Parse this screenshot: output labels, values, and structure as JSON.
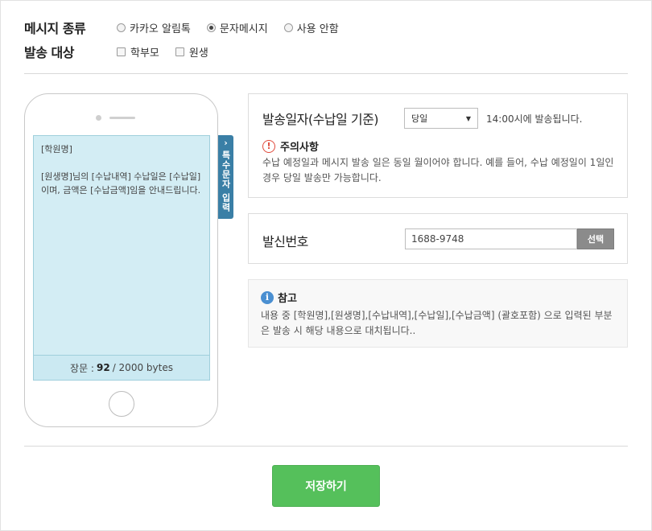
{
  "message_type": {
    "label": "메시지 종류",
    "options": [
      {
        "label": "카카오 알림톡",
        "selected": false
      },
      {
        "label": "문자메시지",
        "selected": true
      },
      {
        "label": "사용 안함",
        "selected": false
      }
    ]
  },
  "send_target": {
    "label": "발송 대상",
    "options": [
      {
        "label": "학부모",
        "checked": false
      },
      {
        "label": "원생",
        "checked": false
      }
    ]
  },
  "phone": {
    "message": "[학원명]\n\n[원생명]님의 [수납내역] 수납일은 [수납일]이며, 금액은 [수납금액]임을 안내드립니다.",
    "counter_prefix": "장문 :",
    "counter_value": "92",
    "counter_suffix": "/ 2000 bytes"
  },
  "special_chars_tab": {
    "chevron": "›",
    "label": "특수문자 입력"
  },
  "send_date": {
    "title": "발송일자(수납일 기준)",
    "selected": "당일",
    "note": "14:00시에 발송됩니다.",
    "warning_title": "주의사항",
    "warning_text": "수납 예정일과 메시지 발송 일은 동일 월이어야 합니다. 예를 들어, 수납 예정일이 1일인 경우 당일 발송만 가능합니다."
  },
  "sender_number": {
    "title": "발신번호",
    "value": "1688-9748",
    "button": "선택"
  },
  "reference": {
    "title": "참고",
    "text": "내용 중 [학원명],[원생명],[수납내역],[수납일],[수납금액] (괄호포함) 으로 입력된 부분은 발송 시 해당 내용으로 대치됩니다.."
  },
  "save_button": "저장하기",
  "colors": {
    "save_green": "#55c05b",
    "tab_blue": "#3a7fa6",
    "screen_bg": "#d3edf4",
    "warning_red": "#e04a3c",
    "info_blue": "#4a8fd1"
  }
}
